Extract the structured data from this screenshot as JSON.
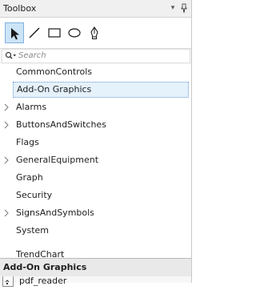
{
  "panel": {
    "title": "Toolbox",
    "dropdown_glyph": "▾",
    "pin_glyph": "ᛘ"
  },
  "tools": [
    {
      "name": "pointer-tool",
      "icon": "arrow-cursor-icon",
      "active": true
    },
    {
      "name": "line-tool",
      "icon": "line-icon",
      "active": false
    },
    {
      "name": "rectangle-tool",
      "icon": "rectangle-icon",
      "active": false
    },
    {
      "name": "ellipse-tool",
      "icon": "ellipse-icon",
      "active": false
    },
    {
      "name": "pen-tool",
      "icon": "pen-icon",
      "active": false
    }
  ],
  "search": {
    "placeholder": "Search",
    "icon": "search-icon"
  },
  "categories": [
    {
      "label": "CommonControls",
      "expandable": false,
      "selected": false
    },
    {
      "label": "Add-On Graphics",
      "expandable": false,
      "selected": true
    },
    {
      "label": "Alarms",
      "expandable": true,
      "selected": false
    },
    {
      "label": "ButtonsAndSwitches",
      "expandable": true,
      "selected": false
    },
    {
      "label": "Flags",
      "expandable": false,
      "selected": false
    },
    {
      "label": "GeneralEquipment",
      "expandable": true,
      "selected": false
    },
    {
      "label": "Graph",
      "expandable": false,
      "selected": false
    },
    {
      "label": "Security",
      "expandable": false,
      "selected": false
    },
    {
      "label": "SignsAndSymbols",
      "expandable": true,
      "selected": false
    },
    {
      "label": "System",
      "expandable": false,
      "selected": false
    },
    {
      "label": "TrendChart",
      "expandable": false,
      "selected": false
    }
  ],
  "group": {
    "title": "Add-On Graphics",
    "items": [
      {
        "label": "pdf_reader",
        "icon": "document-icon"
      }
    ]
  },
  "colors": {
    "selection_fill": "#e5f1fb",
    "selection_border": "#6e9bd1",
    "tool_active": "#cce4f7"
  }
}
